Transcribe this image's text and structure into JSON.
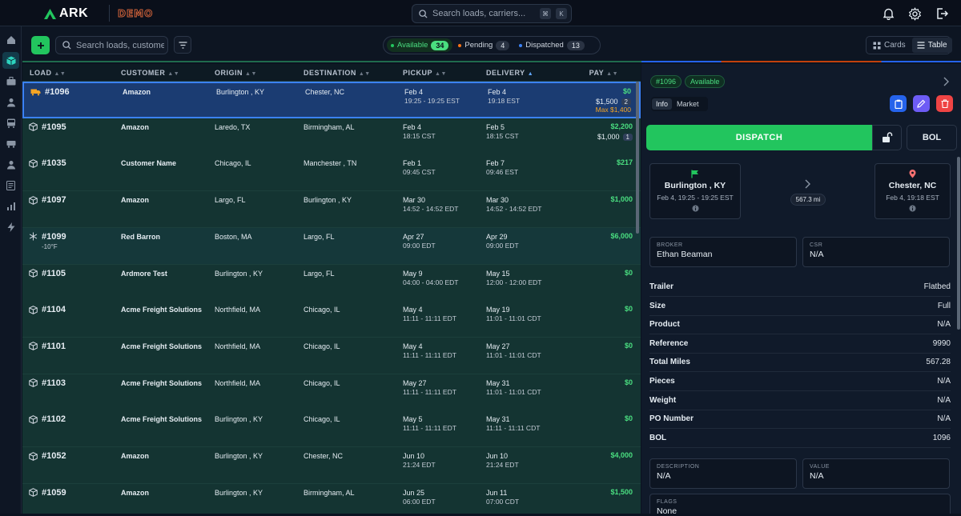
{
  "app": {
    "logo": "ARK",
    "env_badge": "DEMO",
    "global_search_placeholder": "Search loads, carriers...",
    "kbd": [
      "⌘",
      "K"
    ]
  },
  "toolbar": {
    "search_placeholder": "Search loads, customers...",
    "statuses": [
      {
        "label": "Available",
        "count": "34",
        "color": "#22c55e",
        "active": true
      },
      {
        "label": "Pending",
        "count": "4",
        "color": "#f97316",
        "active": false
      },
      {
        "label": "Dispatched",
        "count": "13",
        "color": "#3b82f6",
        "active": false
      }
    ],
    "views": {
      "cards": "Cards",
      "table": "Table"
    }
  },
  "table": {
    "columns": {
      "load": "LOAD",
      "customer": "CUSTOMER",
      "origin": "ORIGIN",
      "destination": "DESTINATION",
      "pickup": "PICKUP",
      "delivery": "DELIVERY",
      "pay": "PAY"
    },
    "rows": [
      {
        "load": "#1096",
        "customer": "Amazon",
        "origin": "Burlington , KY",
        "destination": "Chester, NC",
        "pickup_date": "Feb 4",
        "pickup_time": "19:25 - 19:25 EST",
        "delivery_date": "Feb 4",
        "delivery_time": "19:18 EST",
        "pay": "$0",
        "pay2": "$1,500",
        "badge": "2",
        "max": "Max $1,400"
      },
      {
        "load": "#1095",
        "customer": "Amazon",
        "origin": "Laredo, TX",
        "destination": "Birmingham, AL",
        "pickup_date": "Feb 4",
        "pickup_time": "18:15 CST",
        "delivery_date": "Feb 5",
        "delivery_time": "18:15 CST",
        "pay": "$2,200",
        "pay2": "$1,000",
        "badge": "1"
      },
      {
        "load": "#1035",
        "customer": "Customer Name",
        "origin": "Chicago, IL",
        "destination": "Manchester , TN",
        "pickup_date": "Feb 1",
        "pickup_time": "09:45 CST",
        "delivery_date": "Feb 7",
        "delivery_time": "09:46 EST",
        "pay": "$217"
      },
      {
        "load": "#1097",
        "customer": "Amazon",
        "origin": "Largo, FL",
        "destination": "Burlington , KY",
        "pickup_date": "Mar 30",
        "pickup_time": "14:52 - 14:52 EDT",
        "delivery_date": "Mar 30",
        "delivery_time": "14:52 - 14:52 EDT",
        "pay": "$1,000"
      },
      {
        "load": "#1099",
        "temp": "-10°F",
        "customer": "Red Barron",
        "origin": "Boston, MA",
        "destination": "Largo, FL",
        "pickup_date": "Apr 27",
        "pickup_time": "09:00 EDT",
        "delivery_date": "Apr 29",
        "delivery_time": "09:00 EDT",
        "pay": "$6,000"
      },
      {
        "load": "#1105",
        "customer": "Ardmore Test",
        "origin": "Burlington , KY",
        "destination": "Largo, FL",
        "pickup_date": "May 9",
        "pickup_time": "04:00 - 04:00 EDT",
        "delivery_date": "May 15",
        "delivery_time": "12:00 - 12:00 EDT",
        "pay": "$0"
      },
      {
        "load": "#1104",
        "customer": "Acme Freight Solutions",
        "origin": "Northfield, MA",
        "destination": "Chicago, IL",
        "pickup_date": "May 4",
        "pickup_time": "11:11 - 11:11 EDT",
        "delivery_date": "May 19",
        "delivery_time": "11:01 - 11:01 CDT",
        "pay": "$0"
      },
      {
        "load": "#1101",
        "customer": "Acme Freight Solutions",
        "origin": "Northfield, MA",
        "destination": "Chicago, IL",
        "pickup_date": "May 4",
        "pickup_time": "11:11 - 11:11 EDT",
        "delivery_date": "May 27",
        "delivery_time": "11:01 - 11:01 CDT",
        "pay": "$0"
      },
      {
        "load": "#1103",
        "customer": "Acme Freight Solutions",
        "origin": "Northfield, MA",
        "destination": "Chicago, IL",
        "pickup_date": "May 27",
        "pickup_time": "11:11 - 11:11 EDT",
        "delivery_date": "May 31",
        "delivery_time": "11:01 - 11:01 CDT",
        "pay": "$0"
      },
      {
        "load": "#1102",
        "customer": "Acme Freight Solutions",
        "origin": "Burlington , KY",
        "destination": "Chicago, IL",
        "pickup_date": "May 5",
        "pickup_time": "11:11 - 11:11 EDT",
        "delivery_date": "May 31",
        "delivery_time": "11:11 - 11:11 CDT",
        "pay": "$0"
      },
      {
        "load": "#1052",
        "customer": "Amazon",
        "origin": "Burlington , KY",
        "destination": "Chester, NC",
        "pickup_date": "Jun 10",
        "pickup_time": "21:24 EDT",
        "delivery_date": "Jun 10",
        "delivery_time": "21:24 EDT",
        "pay": "$4,000"
      },
      {
        "load": "#1059",
        "customer": "Amazon",
        "origin": "Burlington , KY",
        "destination": "Birmingham, AL",
        "pickup_date": "Jun 25",
        "pickup_time": "06:00 EDT",
        "delivery_date": "Jun 11",
        "delivery_time": "07:00 CDT",
        "pay": "$1,500"
      }
    ]
  },
  "detail": {
    "load_id": "#1096",
    "status": "Available",
    "tabs": [
      "Info",
      "Market"
    ],
    "dispatch_label": "DISPATCH",
    "bol_label": "BOL",
    "origin": {
      "city": "Burlington , KY",
      "when": "Feb 4, 19:25 - 19:25 EST"
    },
    "destination": {
      "city": "Chester, NC",
      "when": "Feb 4, 19:18 EST"
    },
    "distance": "567.3 mi",
    "broker": {
      "label": "BROKER",
      "value": "Ethan Beaman"
    },
    "csr": {
      "label": "CSR",
      "value": "N/A"
    },
    "fields": [
      {
        "k": "Trailer",
        "v": "Flatbed"
      },
      {
        "k": "Size",
        "v": "Full"
      },
      {
        "k": "Product",
        "v": "N/A"
      },
      {
        "k": "Reference",
        "v": "9990"
      },
      {
        "k": "Total Miles",
        "v": "567.28"
      },
      {
        "k": "Pieces",
        "v": "N/A"
      },
      {
        "k": "Weight",
        "v": "N/A"
      },
      {
        "k": "PO Number",
        "v": "N/A"
      },
      {
        "k": "BOL",
        "v": "1096"
      }
    ],
    "description": {
      "label": "DESCRIPTION",
      "value": "N/A"
    },
    "value": {
      "label": "VALUE",
      "value": "N/A"
    },
    "flags": {
      "label": "FLAGS",
      "value": "None"
    }
  }
}
